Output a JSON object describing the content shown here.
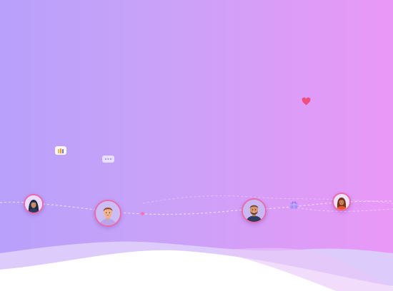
{
  "colors": {
    "gradient_start": "#b8a0fb",
    "gradient_end": "#ea98f7",
    "wave_light": "#dccbfb",
    "wave_white": "#ffffff",
    "avatar_ring": "#ef6aa8",
    "heart": "#ef4f7f",
    "dot": "#f472b6"
  },
  "icons": {
    "avatar_1": "woman-hijab-avatar",
    "avatar_2": "man-avatar",
    "avatar_3": "bearded-man-avatar",
    "avatar_4": "woman-avatar",
    "hands": "raised-hands-icon",
    "chat": "chat-bubble-icon",
    "heart": "heart-icon",
    "gift": "gift-icon"
  }
}
